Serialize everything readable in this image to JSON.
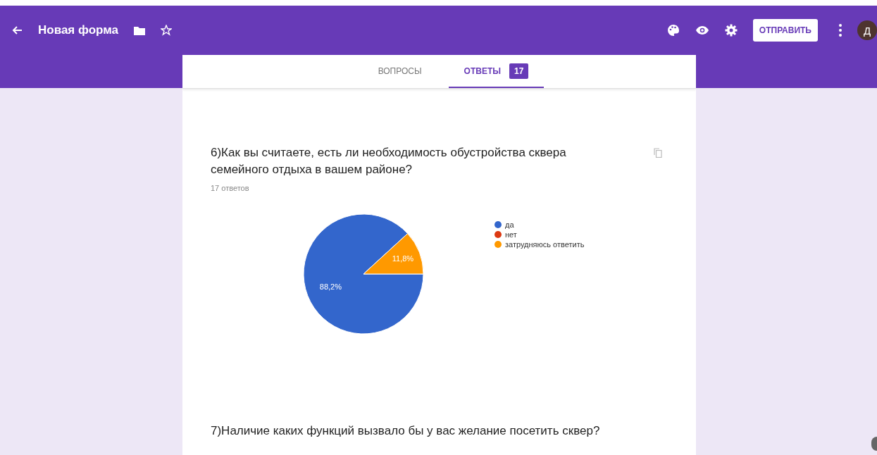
{
  "header": {
    "title": "Новая форма",
    "send_button": "ОТПРАВИТЬ",
    "avatar": "Д"
  },
  "tabs": [
    {
      "label": "ВОПРОСЫ",
      "selected": false
    },
    {
      "label": "ОТВЕТЫ",
      "selected": true,
      "badge": "17"
    }
  ],
  "questions": [
    {
      "title": "6)Как вы считаете, есть ли необходимость обустройства сквера семейного отдыха в вашем районе?",
      "count": "17 ответов",
      "chart_data": {
        "type": "pie",
        "categories": [
          "да",
          "нет",
          "затрудняюсь ответить"
        ],
        "values": [
          88.2,
          0,
          11.8
        ],
        "colors": [
          "#3366cc",
          "#dc3912",
          "#ff9900"
        ],
        "value_labels": [
          "88,2%",
          null,
          "11,8%"
        ],
        "legend": "right"
      }
    },
    {
      "title": "7)Наличие каких функций вызвало бы у вас желание посетить сквер?"
    }
  ]
}
